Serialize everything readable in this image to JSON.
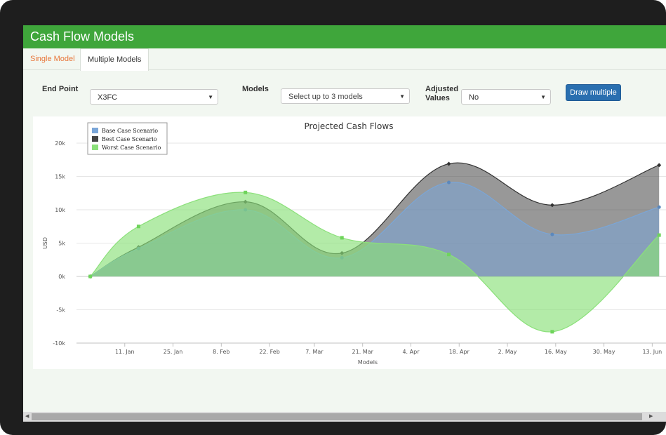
{
  "app": {
    "title": "Cash Flow Models"
  },
  "tabs": [
    {
      "label": "Single Model"
    },
    {
      "label": "Multiple Models"
    }
  ],
  "controls": {
    "end_point": {
      "label": "End Point",
      "value": "X3FC"
    },
    "models": {
      "label": "Models",
      "placeholder": "Select up to 3 models"
    },
    "adjusted": {
      "label_line1": "Adjusted",
      "label_line2": "Values",
      "value": "No"
    },
    "draw_button": "Draw multiple"
  },
  "chart_data": {
    "type": "area",
    "title": "Projected Cash Flows",
    "xlabel": "Models",
    "ylabel": "USD",
    "xlim": [
      "2014-12-28",
      "2015-06-17"
    ],
    "ylim": [
      -10000,
      20000
    ],
    "yticks": [
      -10000,
      -5000,
      0,
      5000,
      10000,
      15000,
      20000
    ],
    "ytick_labels": [
      "-10k",
      "-5k",
      "0k",
      "5k",
      "10k",
      "15k",
      "20k"
    ],
    "xticks": [
      "2015-01-11",
      "2015-01-25",
      "2015-02-08",
      "2015-02-22",
      "2015-03-07",
      "2015-03-21",
      "2015-04-04",
      "2015-04-18",
      "2015-05-02",
      "2015-05-16",
      "2015-05-30",
      "2015-06-13"
    ],
    "xtick_labels": [
      "11. Jan",
      "25. Jan",
      "8. Feb",
      "22. Feb",
      "7. Mar",
      "21. Mar",
      "4. Apr",
      "18. Apr",
      "2. May",
      "16. May",
      "30. May",
      "13. Jun"
    ],
    "x": [
      "2015-01-01",
      "2015-01-15",
      "2015-02-15",
      "2015-03-15",
      "2015-04-15",
      "2015-05-15",
      "2015-06-15"
    ],
    "grid": true,
    "legend_position": "top-left",
    "series": [
      {
        "name": "Base Case Scenario",
        "color": "#7aa6d8",
        "marker": "circle",
        "values": [
          0,
          4200,
          10000,
          2800,
          14100,
          6300,
          10400
        ]
      },
      {
        "name": "Best Case Scenario",
        "color": "#444444",
        "marker": "diamond",
        "values": [
          0,
          4400,
          11200,
          3500,
          16900,
          10700,
          16700
        ]
      },
      {
        "name": "Worst Case Scenario",
        "color": "#8be07a",
        "marker": "square",
        "values": [
          0,
          7500,
          12600,
          5800,
          3300,
          -8300,
          6200
        ]
      }
    ]
  }
}
